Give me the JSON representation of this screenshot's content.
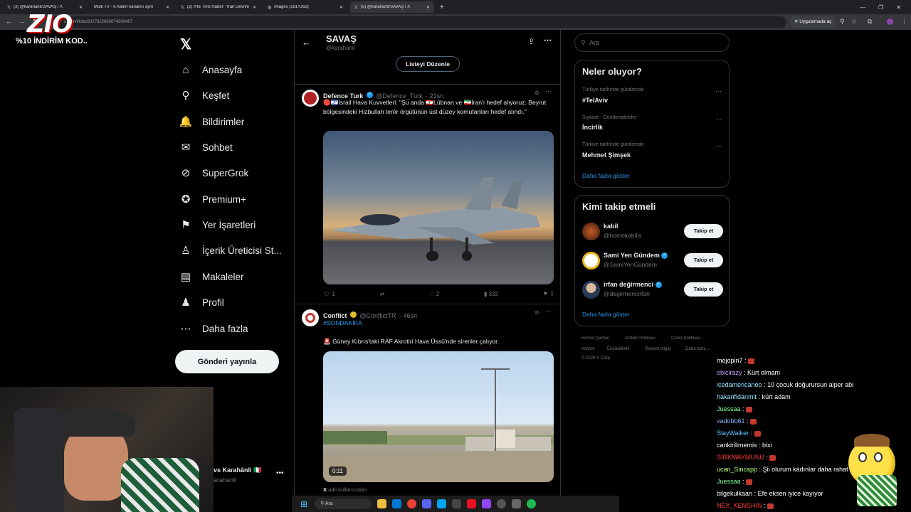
{
  "browser": {
    "tabs": [
      {
        "label": "(3) @karahanli/SAVAŞ / X",
        "active": false
      },
      {
        "label": "Multi TV - 6 haber kanalını aynı",
        "active": false
      },
      {
        "label": "(2) X'te THS Haber: \"İran Devrim",
        "active": false
      },
      {
        "label": "images (191×263)",
        "active": false
      },
      {
        "label": "(5) @karahanli/SAVAŞ / X",
        "active": true
      }
    ],
    "url": "x.com/i/lists/2027822690074300467",
    "open_in_app": "Uygulamada aç"
  },
  "overlay": {
    "logo": "ZIO",
    "promo": "%10 İNDİRİM KOD.."
  },
  "nav": {
    "items": [
      {
        "label": "Anasayfa",
        "icon": "home-icon",
        "glyph": "⌂"
      },
      {
        "label": "Keşfet",
        "icon": "search-icon",
        "glyph": "⚲"
      },
      {
        "label": "Bildirimler",
        "icon": "bell-icon",
        "glyph": "🔔"
      },
      {
        "label": "Sohbet",
        "icon": "mail-icon",
        "glyph": "✉"
      },
      {
        "label": "SuperGrok",
        "icon": "grok-icon",
        "glyph": "⊘"
      },
      {
        "label": "Premium+",
        "icon": "premium-icon",
        "glyph": "✪"
      },
      {
        "label": "Yer İşaretleri",
        "icon": "bookmark-icon",
        "glyph": "⚑"
      },
      {
        "label": "İçerik Üreticisi St...",
        "icon": "creator-studio-icon",
        "glyph": "♙"
      },
      {
        "label": "Makaleler",
        "icon": "articles-icon",
        "glyph": "▤"
      },
      {
        "label": "Profil",
        "icon": "profile-icon",
        "glyph": "♟"
      },
      {
        "label": "Daha fazla",
        "icon": "more-circle-icon",
        "glyph": "⋯"
      }
    ],
    "post_button": "Gönderi yayınla",
    "account_name": "vs Karahânli 🇮🇹",
    "account_handle": "arahanli"
  },
  "list_header": {
    "title": "SAVAŞ",
    "handle": "@karahanli",
    "edit_button": "Listeyi Düzenle"
  },
  "tweets": [
    {
      "name": "Defence Turk",
      "handle": "@Defence_Turk",
      "time": "· 21sn",
      "text": "🔴🇮🇱İsrail Hava Kuvvetleri: \"Şu anda 🇱🇧Lübnan ve 🇮🇷İran'ı hedef alıyoruz. Beyrut bölgesindeki Hizbullah terör örgütünün üst düzey komutanları hedef alındı.\"",
      "replies": "1",
      "reposts": "",
      "likes": "2",
      "views": "332"
    },
    {
      "name": "Conflict",
      "handle": "@ConflictTR",
      "time": "· 46sn",
      "hashtag": "#SONDAKİKA",
      "text": "🚨 Güney Kıbrıs'taki RAF Akrotiri Hava Üssü'nde sirenler çalıyor.",
      "video_time": "0:11",
      "footer": "adlı kullanıcıdan"
    }
  ],
  "search": {
    "placeholder": "Ara"
  },
  "trends": {
    "title": "Neler oluyor?",
    "items": [
      {
        "meta": "Türkiye tarihinde gündemde",
        "topic": "#TelAviv"
      },
      {
        "meta": "Siyaset · Gündemdekiler",
        "topic": "İncirlik"
      },
      {
        "meta": "Türkiye tarihinde gündemde",
        "topic": "Mehmet Şimşek"
      }
    ],
    "show_more": "Daha fazla göster"
  },
  "who_to_follow": {
    "title": "Kimi takip etmeli",
    "items": [
      {
        "name": "kabil",
        "handle": "@homokabilis",
        "button": "Takip et",
        "verified": false
      },
      {
        "name": "Sami Yen Gündem",
        "handle": "@SamiYenGundem",
        "button": "Takip et",
        "verified": true
      },
      {
        "name": "irfan değirmenci",
        "handle": "@degirmencirfan",
        "button": "Takip et",
        "verified": true
      }
    ],
    "show_more": "Daha fazla göster"
  },
  "footer_links": [
    "Hizmet Şartları",
    "Gizlilik Politikası",
    "Çerez Politikası",
    "Imprint",
    "Erişilebilirlik",
    "Reklam bilgisi",
    "Daha fazla ...",
    "© 2026 X Corp."
  ],
  "chat": [
    {
      "user": "mojopin7",
      "msg": "",
      "color": "#ffffff",
      "emote": true
    },
    {
      "user": "obicirazy",
      "msg": "Kürt olmam",
      "color": "#c9a0ff",
      "emote": false
    },
    {
      "user": "icedamericanoo",
      "msg": "10 çocuk doğurursun alper abi",
      "color": "#8ee3ff",
      "emote": false
    },
    {
      "user": "hakanfidanmit",
      "msg": "kürt adam",
      "color": "#9be8ff",
      "emote": false
    },
    {
      "user": "Juessaa",
      "msg": "",
      "color": "#7dff9a",
      "emote": true
    },
    {
      "user": "vadobb61",
      "msg": "",
      "color": "#8ab4ff",
      "emote": true
    },
    {
      "user": "SlayWalker",
      "msg": "",
      "color": "#5cc8ff",
      "emote": true
    },
    {
      "user": "cankirilimemis",
      "msg": "bixi",
      "color": "#ffffff",
      "emote": false
    },
    {
      "user": "SIRKMAYMUNU",
      "msg": "",
      "color": "#ff3b3b",
      "emote": true
    },
    {
      "user": "ucan_Sincapp",
      "msg": "Şii olurum kadınlar daha rahat orda",
      "color": "#b7ff7a",
      "emote": false
    },
    {
      "user": "Juessaa",
      "msg": "",
      "color": "#7dff9a",
      "emote": true
    },
    {
      "user": "bilgekulkaan",
      "msg": "Efe eksen iyice kayıyor",
      "color": "#ffffff",
      "emote": false
    },
    {
      "user": "NEX_KENSHIN",
      "msg": "",
      "color": "#ff3b3b",
      "emote": true
    }
  ],
  "taskbar": {
    "search": "Ara"
  },
  "colors": {
    "accent": "#1d9bf0",
    "border": "#2f3336",
    "muted": "#71767b"
  }
}
